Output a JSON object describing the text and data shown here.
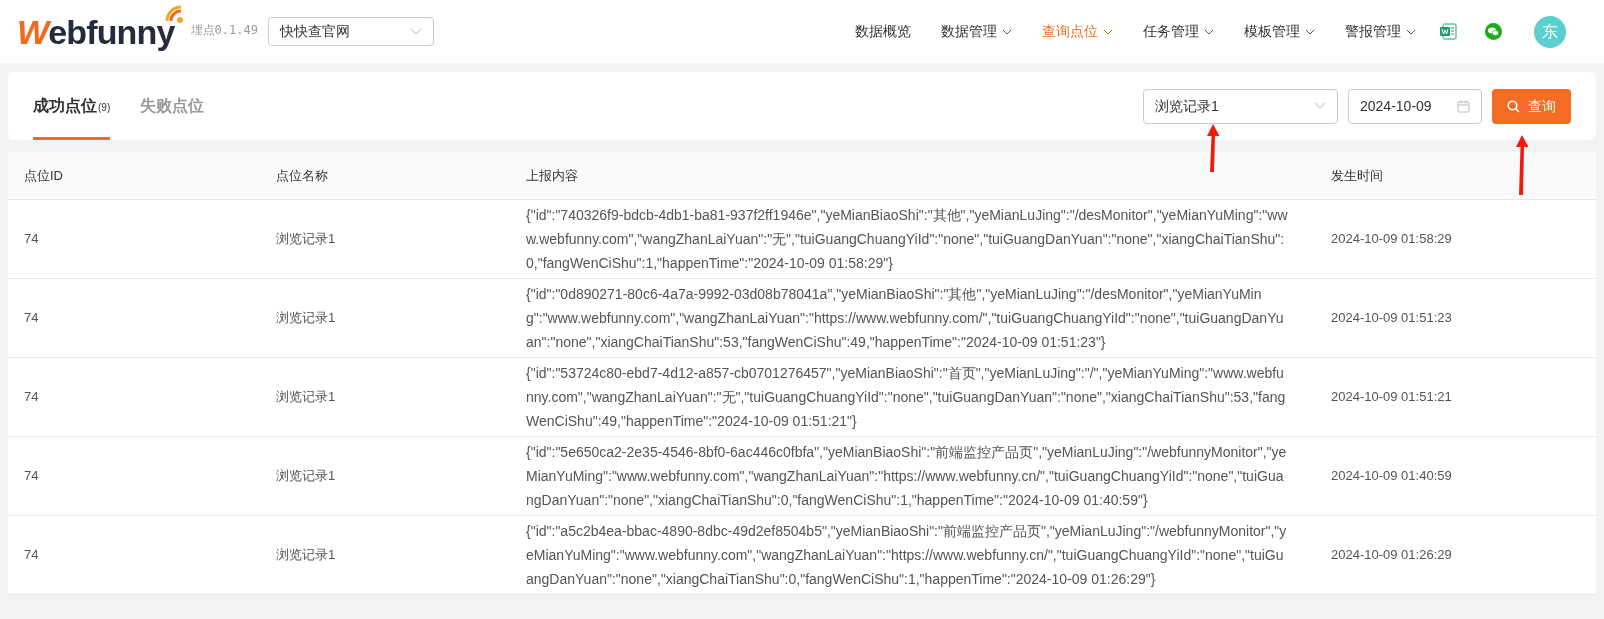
{
  "header": {
    "logo": "Webfunny",
    "version": "埋点0.1.49",
    "site_select": {
      "value": "快快查官网"
    },
    "nav": [
      {
        "label": "数据概览",
        "has_menu": false,
        "selected": false
      },
      {
        "label": "数据管理",
        "has_menu": true,
        "selected": false
      },
      {
        "label": "查询点位",
        "has_menu": true,
        "selected": true
      },
      {
        "label": "任务管理",
        "has_menu": true,
        "selected": false
      },
      {
        "label": "模板管理",
        "has_menu": true,
        "selected": false
      },
      {
        "label": "警报管理",
        "has_menu": true,
        "selected": false
      }
    ],
    "avatar": "东"
  },
  "filter_bar": {
    "tabs": [
      {
        "label": "成功点位",
        "count": "(9)",
        "selected": true
      },
      {
        "label": "失败点位",
        "selected": false
      }
    ],
    "point_select": {
      "value": "浏览记录1"
    },
    "date_field": {
      "value": "2024-10-09"
    },
    "query_button": "查询"
  },
  "table": {
    "columns": [
      "点位ID",
      "点位名称",
      "上报内容",
      "发生时间"
    ],
    "rows": [
      [
        "74",
        "浏览记录1",
        "{\"id\":\"740326f9-bdcb-4db1-ba81-937f2ff1946e\",\"yeMianBiaoShi\":\"其他\",\"yeMianLuJing\":\"/desMonitor\",\"yeMianYuMing\":\"www.webfunny.com\",\"wangZhanLaiYuan\":\"无\",\"tuiGuangChuangYiId\":\"none\",\"tuiGuangDanYuan\":\"none\",\"xiangChaiTianShu\":0,\"fangWenCiShu\":1,\"happenTime\":\"2024-10-09 01:58:29\"}",
        "2024-10-09 01:58:29"
      ],
      [
        "74",
        "浏览记录1",
        "{\"id\":\"0d890271-80c6-4a7a-9992-03d08b78041a\",\"yeMianBiaoShi\":\"其他\",\"yeMianLuJing\":\"/desMonitor\",\"yeMianYuMing\":\"www.webfunny.com\",\"wangZhanLaiYuan\":\"https://www.webfunny.com/\",\"tuiGuangChuangYiId\":\"none\",\"tuiGuangDanYuan\":\"none\",\"xiangChaiTianShu\":53,\"fangWenCiShu\":49,\"happenTime\":\"2024-10-09 01:51:23\"}",
        "2024-10-09 01:51:23"
      ],
      [
        "74",
        "浏览记录1",
        "{\"id\":\"53724c80-ebd7-4d12-a857-cb0701276457\",\"yeMianBiaoShi\":\"首页\",\"yeMianLuJing\":\"/\",\"yeMianYuMing\":\"www.webfunny.com\",\"wangZhanLaiYuan\":\"无\",\"tuiGuangChuangYiId\":\"none\",\"tuiGuangDanYuan\":\"none\",\"xiangChaiTianShu\":53,\"fangWenCiShu\":49,\"happenTime\":\"2024-10-09 01:51:21\"}",
        "2024-10-09 01:51:21"
      ],
      [
        "74",
        "浏览记录1",
        "{\"id\":\"5e650ca2-2e35-4546-8bf0-6ac446c0fbfa\",\"yeMianBiaoShi\":\"前端监控产品页\",\"yeMianLuJing\":\"/webfunnyMonitor\",\"yeMianYuMing\":\"www.webfunny.com\",\"wangZhanLaiYuan\":\"https://www.webfunny.cn/\",\"tuiGuangChuangYiId\":\"none\",\"tuiGuangDanYuan\":\"none\",\"xiangChaiTianShu\":0,\"fangWenCiShu\":1,\"happenTime\":\"2024-10-09 01:40:59\"}",
        "2024-10-09 01:40:59"
      ],
      [
        "74",
        "浏览记录1",
        "{\"id\":\"a5c2b4ea-bbac-4890-8dbc-49d2ef8504b5\",\"yeMianBiaoShi\":\"前端监控产品页\",\"yeMianLuJing\":\"/webfunnyMonitor\",\"yeMianYuMing\":\"www.webfunny.com\",\"wangZhanLaiYuan\":\"https://www.webfunny.cn/\",\"tuiGuangChuangYiId\":\"none\",\"tuiGuangDanYuan\":\"none\",\"xiangChaiTianShu\":0,\"fangWenCiShu\":1,\"happenTime\":\"2024-10-09 01:26:29\"}",
        "2024-10-09 01:26:29"
      ]
    ]
  }
}
